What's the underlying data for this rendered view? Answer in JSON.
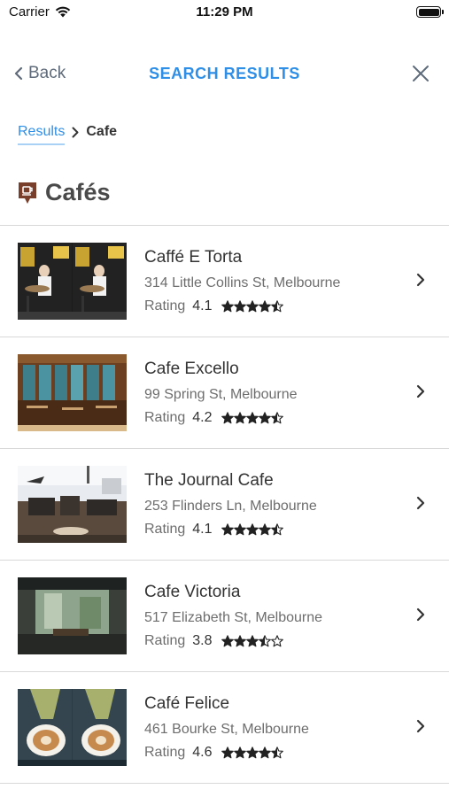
{
  "status": {
    "carrier": "Carrier",
    "time": "11:29 PM"
  },
  "nav": {
    "back_label": "Back",
    "title": "SEARCH RESULTS"
  },
  "breadcrumb": {
    "parent": "Results",
    "current": "Cafe"
  },
  "section": {
    "title": "Cafés",
    "icon": "cafe-icon"
  },
  "colors": {
    "accent": "#2f8fe6",
    "icon_brown": "#7a3f2b"
  },
  "results": [
    {
      "name": "Caffé E Torta",
      "address": "314 Little Collins St, Melbourne",
      "rating_label": "Rating",
      "rating": "4.1",
      "stars": 4.5,
      "thumb": "caffe-e-torta-photo"
    },
    {
      "name": "Cafe Excello",
      "address": "99 Spring St, Melbourne",
      "rating_label": "Rating",
      "rating": "4.2",
      "stars": 4.5,
      "thumb": "cafe-excello-photo"
    },
    {
      "name": "The Journal Cafe",
      "address": "253 Flinders Ln, Melbourne",
      "rating_label": "Rating",
      "rating": "4.1",
      "stars": 4.5,
      "thumb": "journal-cafe-photo"
    },
    {
      "name": "Cafe Victoria",
      "address": "517 Elizabeth St, Melbourne",
      "rating_label": "Rating",
      "rating": "3.8",
      "stars": 3.5,
      "thumb": "cafe-victoria-photo"
    },
    {
      "name": "Café Felice",
      "address": "461 Bourke St, Melbourne",
      "rating_label": "Rating",
      "rating": "4.6",
      "stars": 4.5,
      "thumb": "cafe-felice-photo"
    }
  ]
}
